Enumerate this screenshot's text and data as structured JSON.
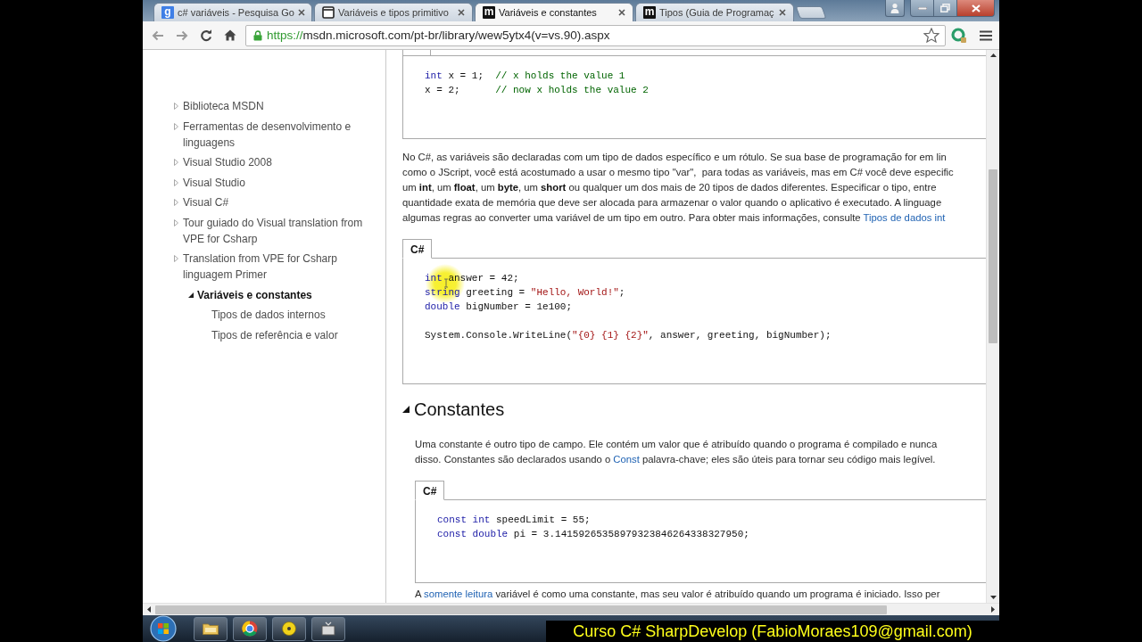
{
  "browser": {
    "tabs": [
      {
        "title": "c# variáveis - Pesquisa Go",
        "kind": "letter",
        "letter": "g",
        "color": "#3f7fe6",
        "selected": false
      },
      {
        "title": "Variáveis e tipos primitivo",
        "kind": "page",
        "selected": false
      },
      {
        "title": "Variáveis e constantes",
        "kind": "letter",
        "letter": "m",
        "color": "#111111",
        "selected": true
      },
      {
        "title": "Tipos (Guia de Programaç",
        "kind": "letter",
        "letter": "m",
        "color": "#111111",
        "selected": false
      }
    ],
    "address_bar": {
      "scheme": "https://",
      "rest": "msdn.microsoft.com/pt-br/library/wew5ytx4(v=vs.90).aspx"
    }
  },
  "sidebar": {
    "items": [
      {
        "label": "Biblioteca MSDN",
        "expanded": false,
        "selected": false
      },
      {
        "label": "Ferramentas de desenvolvimento e linguagens",
        "expanded": false,
        "selected": false
      },
      {
        "label": "Visual Studio 2008",
        "expanded": false,
        "selected": false
      },
      {
        "label": "Visual Studio",
        "expanded": false,
        "selected": false
      },
      {
        "label": "Visual C#",
        "expanded": false,
        "selected": false
      },
      {
        "label": "Tour guiado do Visual translation from VPE for Csharp",
        "expanded": false,
        "selected": false
      },
      {
        "label": "Translation from VPE for Csharp linguagem Primer",
        "expanded": false,
        "selected": false,
        "children": [
          {
            "label": "Variáveis e constantes",
            "expanded": true,
            "selected": true,
            "children": [
              {
                "label": "Tipos de dados internos",
                "selected": false
              },
              {
                "label": "Tipos de referência e valor",
                "selected": false
              }
            ]
          }
        ]
      }
    ]
  },
  "content": {
    "blocks": [
      {
        "kind": "code",
        "groups": [
          [
            [
              {
                "kind": "keyword",
                "text": "int"
              },
              {
                "kind": "plain",
                "text": " x = 1;  "
              },
              {
                "kind": "comment",
                "text": "// x holds the value 1"
              }
            ],
            [
              {
                "kind": "plain",
                "text": "x = 2;      "
              },
              {
                "kind": "comment",
                "text": "// now x holds the value 2"
              }
            ]
          ]
        ]
      },
      {
        "kind": "paragraph",
        "lines": [
          [
            {
              "kind": "text",
              "text": "No C#, as variáveis são declaradas com um tipo de dados específico e um rótulo. Se sua base de programação for em lin"
            }
          ],
          [
            {
              "kind": "text",
              "text": "como o JScript, você está acostumado a usar o mesmo tipo \"var\",  para todas as variáveis, mas em C# você deve especific"
            }
          ],
          [
            {
              "kind": "text",
              "text": "um **int**, um **float**, um **byte**, um **short** ou qualquer um dos mais de 20 tipos de dados diferentes. Especificar o tipo, entre"
            }
          ],
          [
            {
              "kind": "text",
              "text": "quantidade exata de memória que deve ser alocada para armazenar o valor quando o aplicativo é executado. A linguage"
            }
          ],
          [
            {
              "kind": "text",
              "text": "algumas regras ao converter uma variável de um tipo em outro. Para obter mais informações, consulte "
            },
            {
              "kind": "link",
              "text": "Tipos de dados int"
            }
          ]
        ]
      },
      {
        "kind": "code",
        "tab": "C#",
        "groups": [
          [
            [
              {
                "kind": "keyword",
                "text": "int"
              },
              {
                "kind": "plain",
                "text": " answer = 42;"
              }
            ],
            [
              {
                "kind": "keyword",
                "text": "string"
              },
              {
                "kind": "plain",
                "text": " greeting = "
              },
              {
                "kind": "string",
                "text": "\"Hello, World!\""
              },
              {
                "kind": "plain",
                "text": ";"
              }
            ],
            [
              {
                "kind": "keyword",
                "text": "double"
              },
              {
                "kind": "plain",
                "text": " bigNumber = 1e100;"
              }
            ]
          ],
          [
            [
              {
                "kind": "plain",
                "text": "System.Console.WriteLine("
              },
              {
                "kind": "string",
                "text": "\"{0} {1} {2}\""
              },
              {
                "kind": "plain",
                "text": ", answer, greeting, bigNumber);"
              }
            ]
          ]
        ]
      }
    ],
    "sections": [
      {
        "heading": "Constantes",
        "expanded": true,
        "blocks": [
          {
            "kind": "paragraph",
            "lines": [
              [
                {
                  "kind": "text",
                  "text": "Uma constante é outro tipo de campo. Ele contém um valor que é atribuído quando o programa é compilado e nunca"
                }
              ],
              [
                {
                  "kind": "text",
                  "text": "disso. Constantes são declarados usando o "
                },
                {
                  "kind": "link",
                  "text": "Const"
                },
                {
                  "kind": "text",
                  "text": " palavra-chave; eles são úteis para tornar seu código mais legível."
                }
              ]
            ]
          },
          {
            "kind": "code",
            "tab": "C#",
            "groups": [
              [
                [
                  {
                    "kind": "keyword",
                    "text": "const int"
                  },
                  {
                    "kind": "plain",
                    "text": " speedLimit = 55;"
                  }
                ],
                [
                  {
                    "kind": "keyword",
                    "text": "const double"
                  },
                  {
                    "kind": "plain",
                    "text": " pi = 3.14159265358979323846264338327950;"
                  }
                ]
              ]
            ]
          },
          {
            "kind": "paragraph",
            "lines": [
              [
                {
                  "kind": "text",
                  "text": "A "
                },
                {
                  "kind": "link",
                  "text": "somente leitura"
                },
                {
                  "kind": "text",
                  "text": " variável é como uma constante, mas seu valor é atribuído quando um programa é iniciado. Isso per"
                }
              ]
            ]
          }
        ]
      }
    ]
  },
  "caption": "Curso C# SharpDevelop (FabioMoraes109@gmail.com)"
}
